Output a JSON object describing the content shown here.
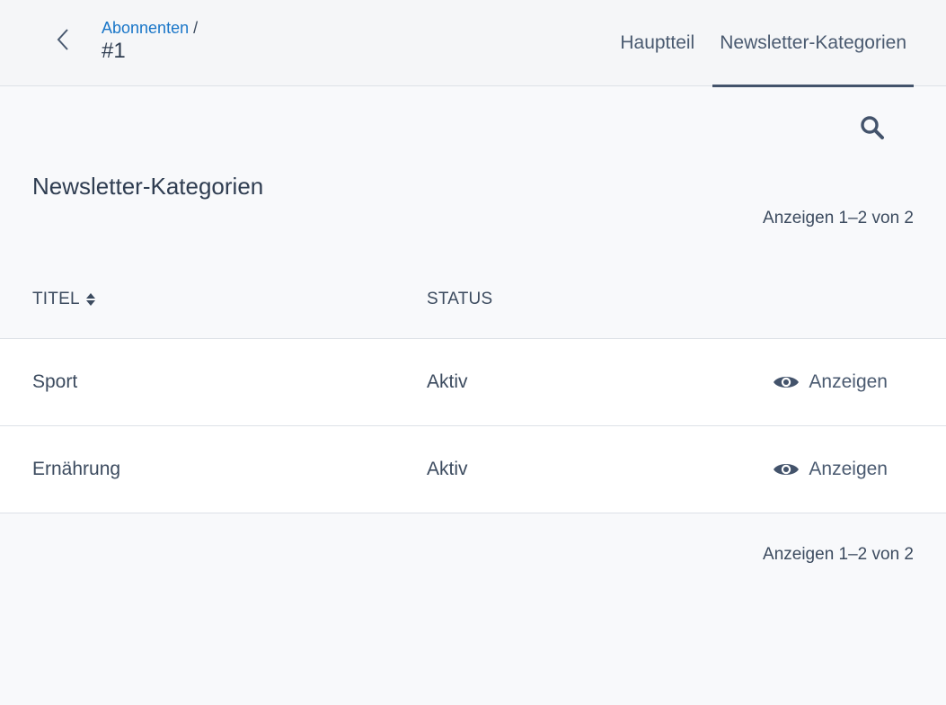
{
  "header": {
    "breadcrumb_link": "Abonnenten",
    "breadcrumb_sep": " /",
    "record_id": "#1",
    "tabs": [
      {
        "label": "Hauptteil",
        "active": false
      },
      {
        "label": "Newsletter-Kategorien",
        "active": true
      }
    ]
  },
  "main": {
    "title": "Newsletter-Kategorien",
    "count_top": "Anzeigen 1–2 von 2",
    "count_bottom": "Anzeigen 1–2 von 2",
    "columns": {
      "title": "TITEL",
      "status": "STATUS"
    },
    "rows": [
      {
        "title": "Sport",
        "status": "Aktiv",
        "action": "Anzeigen"
      },
      {
        "title": "Ernährung",
        "status": "Aktiv",
        "action": "Anzeigen"
      }
    ]
  },
  "icons": {
    "back": "chevron-left-icon",
    "search": "search-icon",
    "sort": "sort-icon",
    "view": "eye-icon"
  },
  "colors": {
    "link": "#1976c8",
    "text": "#3c4b5f",
    "tab_underline": "#43536b",
    "header_bg": "#f5f6f8",
    "page_bg": "#f8f9fb",
    "row_bg": "#ffffff"
  }
}
